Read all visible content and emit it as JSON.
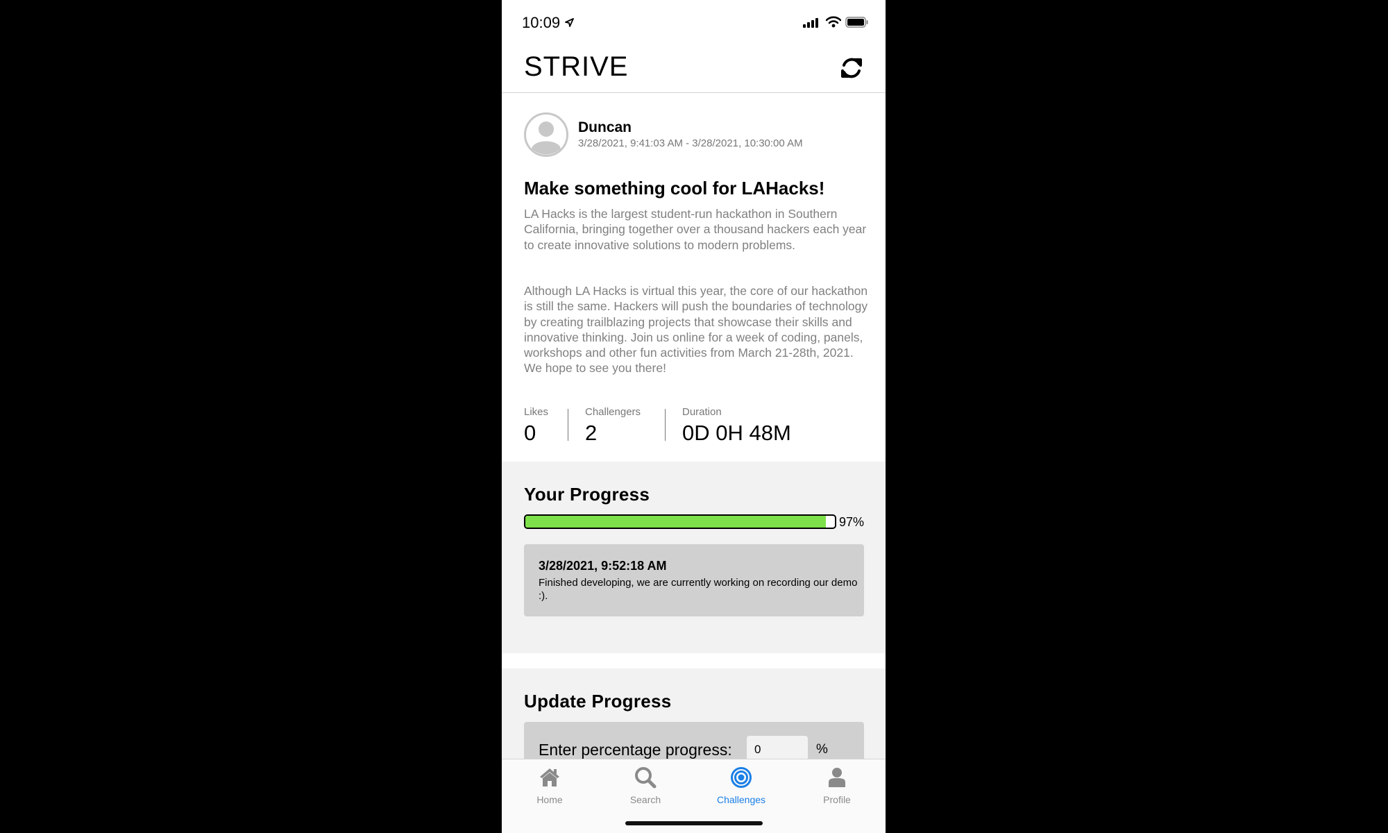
{
  "status_bar": {
    "time": "10:09"
  },
  "header": {
    "app_title": "STRIVE",
    "refresh_icon": "refresh-icon"
  },
  "post": {
    "author": "Duncan",
    "dates": "3/28/2021, 9:41:03 AM - 3/28/2021, 10:30:00 AM",
    "title": "Make something cool for LAHacks!",
    "description_p1": "LA Hacks is the largest student-run hackathon in Southern California, bringing together over a thousand hackers each year to create innovative solutions to modern problems.",
    "description_p2": "Although LA Hacks is virtual this year, the core of our hackathon is still the same. Hackers will push the boundaries of technology by creating trailblazing projects that showcase their skills and innovative thinking. Join us online for a week of coding, panels, workshops and other fun activities from March 21-28th, 2021. We hope to see you there!",
    "stats": {
      "likes_label": "Likes",
      "likes_value": "0",
      "challengers_label": "Challengers",
      "challengers_value": "2",
      "duration_label": "Duration",
      "duration_value": "0D 0H 48M"
    }
  },
  "your_progress": {
    "heading": "Your Progress",
    "percent": 97,
    "percent_label": "97%",
    "bar_color": "#7ee04a",
    "entry": {
      "time": "3/28/2021, 9:52:18 AM",
      "text": "Finished developing, we are currently working on recording our demo :)."
    }
  },
  "update_progress": {
    "heading": "Update Progress",
    "input_label": "Enter percentage progress:",
    "input_value": "0",
    "percent_sign": "%"
  },
  "tab_bar": {
    "active_color": "#1a7fe6",
    "tabs": [
      {
        "label": "Home",
        "icon": "home-icon"
      },
      {
        "label": "Search",
        "icon": "search-icon"
      },
      {
        "label": "Challenges",
        "icon": "target-icon",
        "active": true
      },
      {
        "label": "Profile",
        "icon": "person-icon"
      }
    ]
  }
}
